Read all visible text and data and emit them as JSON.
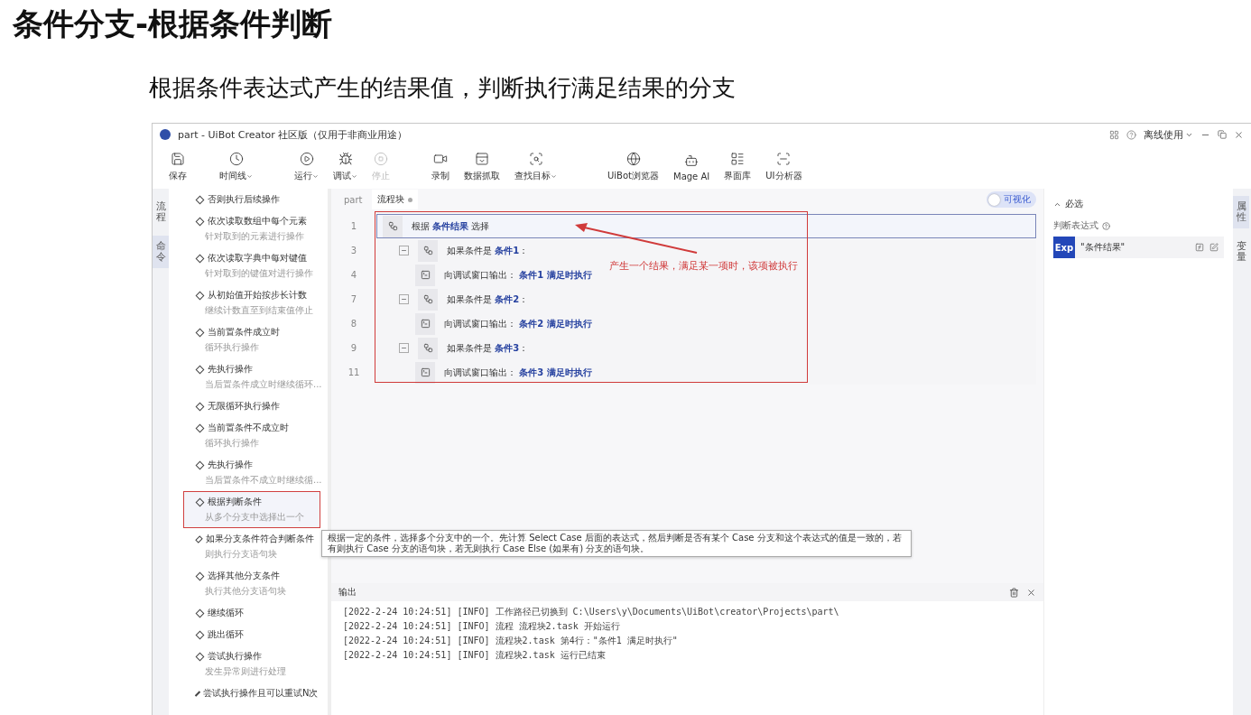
{
  "heading": {
    "title": "条件分支-根据条件判断",
    "subtitle": "根据条件表达式产生的结果值，判断执行满足结果的分支"
  },
  "window": {
    "title": "part - UiBot Creator 社区版（仅用于非商业用途）",
    "mode_menu": "离线使用"
  },
  "toolbar": [
    {
      "label": "保存",
      "dropdown": false,
      "disabled": false
    },
    {
      "label": "时间线",
      "dropdown": true,
      "disabled": false
    },
    {
      "label": "运行",
      "dropdown": true,
      "disabled": false
    },
    {
      "label": "调试",
      "dropdown": true,
      "disabled": false
    },
    {
      "label": "停止",
      "dropdown": false,
      "disabled": true
    },
    {
      "label": "录制",
      "dropdown": false,
      "disabled": false
    },
    {
      "label": "数据抓取",
      "dropdown": false,
      "disabled": false
    },
    {
      "label": "查找目标",
      "dropdown": true,
      "disabled": false
    },
    {
      "label": "UiBot浏览器",
      "dropdown": false,
      "disabled": false
    },
    {
      "label": "Mage AI",
      "dropdown": false,
      "disabled": false
    },
    {
      "label": "界面库",
      "dropdown": false,
      "disabled": false
    },
    {
      "label": "UI分析器",
      "dropdown": false,
      "disabled": false
    }
  ],
  "left_tabs": [
    {
      "label": "流程",
      "selected": false
    },
    {
      "label": "命令",
      "selected": true
    }
  ],
  "commands": [
    {
      "title": "否则执行后续操作",
      "selected": false
    },
    {
      "title": "依次读取数组中每个元素",
      "subtitle": "针对取到的元素进行操作",
      "selected": false
    },
    {
      "title": "依次读取字典中每对键值",
      "subtitle": "针对取到的键值对进行操作",
      "selected": false
    },
    {
      "title": "从初始值开始按步长计数",
      "subtitle": "继续计数直至到结束值停止",
      "selected": false
    },
    {
      "title": "当前置条件成立时",
      "subtitle": "循环执行操作",
      "selected": false
    },
    {
      "title": "先执行操作",
      "subtitle": "当后置条件成立时继续循环...",
      "selected": false
    },
    {
      "title": "无限循环执行操作",
      "selected": false
    },
    {
      "title": "当前置条件不成立时",
      "subtitle": "循环执行操作",
      "selected": false
    },
    {
      "title": "先执行操作",
      "subtitle": "当后置条件不成立时继续循...",
      "selected": false
    },
    {
      "title": "根据判断条件",
      "subtitle": "从多个分支中选择出一个",
      "selected": true
    },
    {
      "title": "如果分支条件符合判断条件",
      "subtitle": "则执行分支语句块",
      "selected": false
    },
    {
      "title": "选择其他分支条件",
      "subtitle": "执行其他分支语句块",
      "selected": false
    },
    {
      "title": "继续循环",
      "selected": false
    },
    {
      "title": "跳出循环",
      "selected": false
    },
    {
      "title": "尝试执行操作",
      "subtitle": "发生异常则进行处理",
      "selected": false
    },
    {
      "title": "尝试执行操作且可以重试N次",
      "selected": false
    }
  ],
  "tooltip": "根据一定的条件，选择多个分支中的一个。先计算 Select Case 后面的表达式，然后判断是否有某个 Case 分支和这个表达式的值是一致的，若有则执行 Case 分支的语句块，若无则执行 Case Else (如果有) 分支的语句块。",
  "editor": {
    "tabs": [
      {
        "label": "part",
        "selected": false,
        "modified": false
      },
      {
        "label": "流程块",
        "selected": true,
        "modified": true
      }
    ],
    "visualize": {
      "label": "可视化",
      "on": false
    },
    "lines": [
      {
        "number": "1",
        "kind": "select",
        "text": "根据 **条件结果** 选择",
        "selected": true,
        "children": [
          {
            "number": "3",
            "kind": "case",
            "text": "如果条件是 **条件1**：",
            "selected": false,
            "expanded": true,
            "children": [
              {
                "number": "4",
                "kind": "output",
                "text": "向调试窗口输出： **条件1 满足时执行**",
                "selected": false
              }
            ]
          },
          {
            "number": "7",
            "kind": "case",
            "text": "如果条件是 **条件2**：",
            "selected": false,
            "expanded": true,
            "children": [
              {
                "number": "8",
                "kind": "output",
                "text": "向调试窗口输出： **条件2 满足时执行**",
                "selected": false
              }
            ]
          },
          {
            "number": "9",
            "kind": "case",
            "text": "如果条件是 **条件3**：",
            "selected": false,
            "expanded": true,
            "children": [
              {
                "number": "11",
                "kind": "output",
                "text": "向调试窗口输出： **条件3 满足时执行**",
                "selected": false
              }
            ]
          }
        ]
      }
    ],
    "annotation": "产生一个结果，满足某一项时，该项被执行"
  },
  "properties": {
    "section": "必选",
    "expanded": true,
    "field_label": "判断表达式",
    "badge": "Exp",
    "value": "\"条件结果\""
  },
  "right_tabs": [
    {
      "label": "属性",
      "selected": true
    },
    {
      "label": "变量",
      "selected": false
    }
  ],
  "output": {
    "title": "输出",
    "lines": [
      "[2022-2-24 10:24:51] [INFO] 工作路径已切换到 C:\\Users\\y\\Documents\\UiBot\\creator\\Projects\\part\\",
      "[2022-2-24 10:24:51] [INFO] 流程 流程块2.task 开始运行",
      "[2022-2-24 10:24:51] [INFO] 流程块2.task 第4行：\"条件1 满足时执行\"",
      "[2022-2-24 10:24:51] [INFO] 流程块2.task 运行已结束"
    ]
  }
}
